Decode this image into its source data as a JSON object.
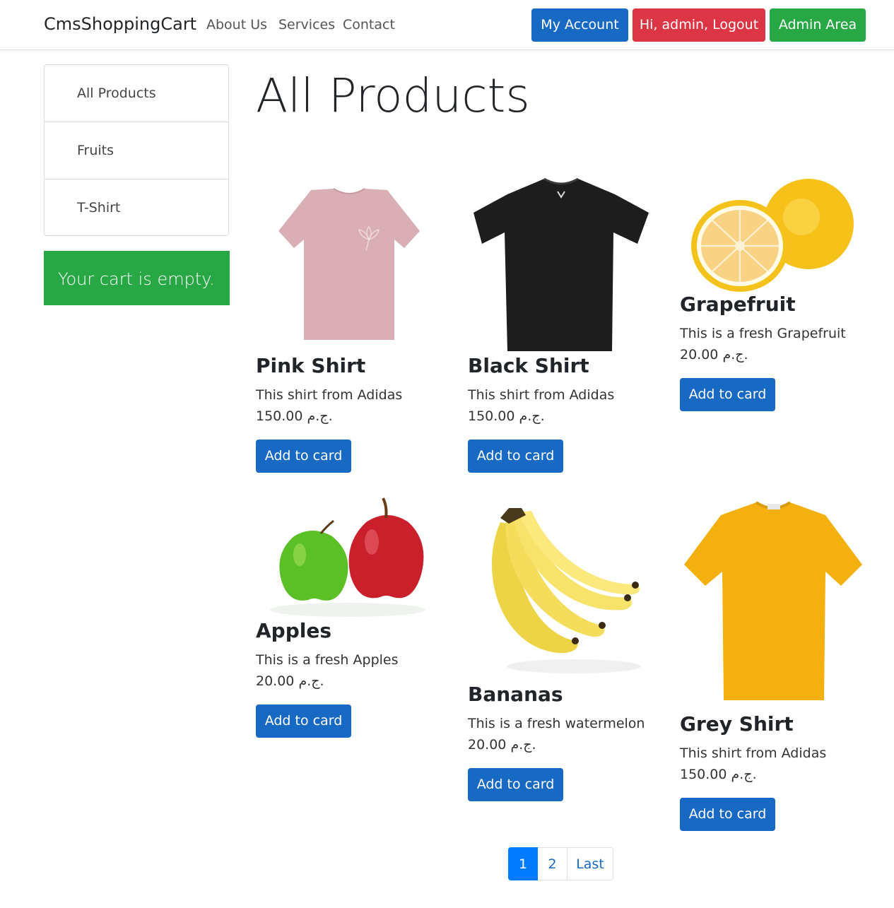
{
  "navbar": {
    "brand": "CmsShoppingCart",
    "links": [
      "About Us",
      "Services",
      "Contact"
    ],
    "my_account": "My Account",
    "logout": "Hi, admin, Logout",
    "admin_area": "Admin Area",
    "colors": {
      "primary": "#1769c3",
      "danger": "#dc3545",
      "success": "#28a745"
    }
  },
  "sidebar": {
    "categories": [
      "All Products",
      "Fruits",
      "T-Shirt"
    ],
    "cart_status": "Your cart is empty."
  },
  "main": {
    "title": "All Products",
    "add_button_label": "Add to card",
    "products": [
      {
        "name": "Pink Shirt",
        "description": "This shirt from Adidas",
        "price": "150.00 ج.م.",
        "image": "pink-tshirt"
      },
      {
        "name": "Black Shirt",
        "description": "This shirt from Adidas",
        "price": "150.00 ج.م.",
        "image": "black-tshirt"
      },
      {
        "name": "Grapefruit",
        "description": "This is a fresh Grapefruit",
        "price": "20.00 ج.م.",
        "image": "grapefruit"
      },
      {
        "name": "Apples",
        "description": "This is a fresh Apples",
        "price": "20.00 ج.م.",
        "image": "apples"
      },
      {
        "name": "Bananas",
        "description": "This is a fresh watermelon",
        "price": "20.00 ج.م.",
        "image": "bananas"
      },
      {
        "name": "Grey Shirt",
        "description": "This shirt from Adidas",
        "price": "150.00 ج.م.",
        "image": "yellow-tshirt"
      }
    ]
  },
  "pagination": {
    "pages": [
      "1",
      "2"
    ],
    "last": "Last",
    "active": "1"
  }
}
